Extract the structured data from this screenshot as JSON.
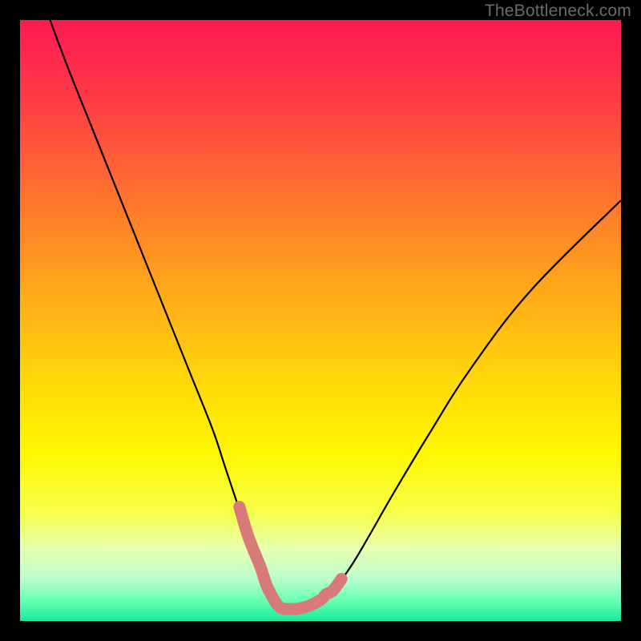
{
  "watermark": "TheBottleneck.com",
  "chart_data": {
    "type": "line",
    "title": "",
    "xlabel": "",
    "ylabel": "",
    "xlim": [
      0,
      100
    ],
    "ylim": [
      0,
      100
    ],
    "grid": false,
    "legend": false,
    "series": [
      {
        "name": "bottleneck-curve",
        "x": [
          5,
          8,
          12,
          16,
          20,
          24,
          28,
          32,
          34,
          36,
          38,
          40,
          41,
          42,
          43,
          44,
          45,
          46,
          48,
          50,
          52,
          55,
          58,
          62,
          68,
          75,
          85,
          100
        ],
        "y": [
          100,
          92,
          82,
          72,
          62,
          52,
          42,
          32,
          26,
          20,
          14,
          9,
          6,
          4,
          2.5,
          2,
          2,
          2,
          2.5,
          3.5,
          5,
          9,
          14,
          21,
          31,
          42,
          55,
          70
        ]
      },
      {
        "name": "curve-highlight",
        "x": [
          36.5,
          38,
          40,
          41,
          42,
          43,
          44,
          45,
          46,
          48,
          50,
          51,
          52,
          53.5
        ],
        "y": [
          19,
          14,
          9,
          6,
          4,
          2.5,
          2,
          2,
          2,
          2.5,
          3.5,
          4.5,
          5,
          7
        ]
      }
    ],
    "background_gradient": {
      "stops": [
        {
          "offset": 0.0,
          "color": "#ff1a52"
        },
        {
          "offset": 0.12,
          "color": "#ff3747"
        },
        {
          "offset": 0.28,
          "color": "#ff6e2f"
        },
        {
          "offset": 0.44,
          "color": "#ffa61a"
        },
        {
          "offset": 0.6,
          "color": "#ffd80a"
        },
        {
          "offset": 0.72,
          "color": "#fff700"
        },
        {
          "offset": 0.82,
          "color": "#f6ff4a"
        },
        {
          "offset": 0.88,
          "color": "#e7ffb0"
        },
        {
          "offset": 0.93,
          "color": "#b9ffcc"
        },
        {
          "offset": 0.97,
          "color": "#5cffb1"
        },
        {
          "offset": 1.0,
          "color": "#18e89a"
        }
      ]
    },
    "colors": {
      "curve": "#000000",
      "highlight": "#d97a7a",
      "frame": "#000000"
    }
  }
}
